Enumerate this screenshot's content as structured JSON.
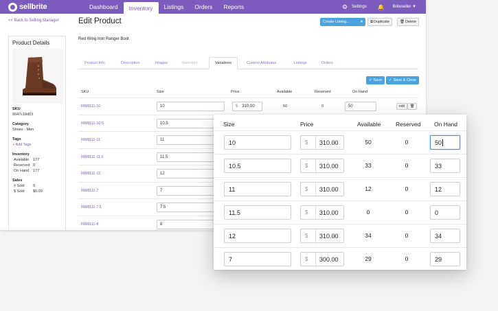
{
  "nav": {
    "logo": "sellbrite",
    "items": [
      "Dashboard",
      "Inventory",
      "Listings",
      "Orders",
      "Reports"
    ],
    "active": "Inventory",
    "settings": "Settings",
    "user": "Briteseller"
  },
  "header": {
    "back_link": "<< Back to Selling Manager",
    "title": "Edit Product",
    "create_listing": "Create Listing...",
    "duplicate": "Duplicate",
    "delete": "Delete"
  },
  "sidebar": {
    "title": "Product Details",
    "sku_label": "SKU",
    "sku": "9047c18d03",
    "category_label": "Category",
    "category": "Shoes - Men",
    "tags_label": "Tags",
    "add_tags": "+ Add Tags",
    "inventory_label": "Inventory",
    "inventory": [
      {
        "label": "Available",
        "value": "177"
      },
      {
        "label": "Reserved",
        "value": "0"
      },
      {
        "label": "On Hand",
        "value": "177"
      }
    ],
    "sales_label": "Sales",
    "sales": [
      {
        "label": "# Sold",
        "value": "0"
      },
      {
        "label": "$ Sold",
        "value": "$0.00"
      }
    ]
  },
  "product": {
    "name": "Red Wing Iron Ranger Boot",
    "tabs": [
      "Product Info",
      "Description",
      "Images",
      "Inventory",
      "Variations",
      "Custom Attributes",
      "Listings",
      "Orders"
    ],
    "active_tab": "Variations",
    "save": "Save",
    "save_close": "Save & Close"
  },
  "variations_table": {
    "headers": [
      "SKU",
      "Size",
      "Price",
      "Available",
      "Reserved",
      "On Hand"
    ],
    "rows": [
      {
        "sku": "RW8111-10",
        "size": "10",
        "price": "310.00",
        "available": "50",
        "reserved": "0",
        "on_hand": "50"
      },
      {
        "sku": "RW8111-10.5",
        "size": "10.5"
      },
      {
        "sku": "RW8111-11",
        "size": "11"
      },
      {
        "sku": "RW8111-11.5",
        "size": "11.5"
      },
      {
        "sku": "RW8111-12",
        "size": "12"
      },
      {
        "sku": "RW8111-7",
        "size": "7"
      },
      {
        "sku": "RW8111-7.5",
        "size": "7.5"
      },
      {
        "sku": "RW8111-8",
        "size": "8"
      }
    ],
    "edit": "edit"
  },
  "zoom_card": {
    "headers": [
      "Size",
      "Price",
      "Available",
      "Reserved",
      "On Hand"
    ],
    "currency": "$",
    "rows": [
      {
        "size": "10",
        "price": "310.00",
        "available": "50",
        "reserved": "0",
        "on_hand": "50"
      },
      {
        "size": "10.5",
        "price": "310.00",
        "available": "33",
        "reserved": "0",
        "on_hand": "33"
      },
      {
        "size": "11",
        "price": "310.00",
        "available": "12",
        "reserved": "0",
        "on_hand": "12"
      },
      {
        "size": "11.5",
        "price": "310.00",
        "available": "0",
        "reserved": "0",
        "on_hand": "0"
      },
      {
        "size": "12",
        "price": "310.00",
        "available": "34",
        "reserved": "0",
        "on_hand": "34"
      },
      {
        "size": "7",
        "price": "300.00",
        "available": "29",
        "reserved": "0",
        "on_hand": "29"
      }
    ]
  },
  "colors": {
    "brand": "#7c5bbf",
    "button_blue": "#4aa3df",
    "focus": "#4a90d9"
  }
}
